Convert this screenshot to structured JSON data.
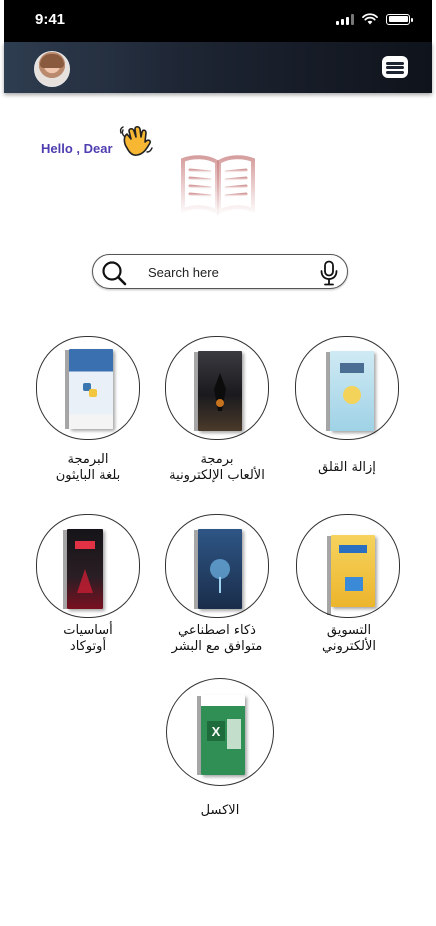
{
  "status_bar": {
    "time": "9:41"
  },
  "header": {
    "avatar": "user-avatar",
    "menu_icon": "menu-list-icon"
  },
  "greeting": {
    "text": "Hello , Dear",
    "icon": "waving-hand-icon"
  },
  "logo": {
    "icon": "open-book-icon"
  },
  "search": {
    "placeholder": "Search here",
    "value": "",
    "search_icon": "search-icon",
    "mic_icon": "microphone-icon"
  },
  "categories": [
    {
      "line1": "البرمجة",
      "line2": "بلغة البايثون",
      "cover_color": "#8fb3d9"
    },
    {
      "line1": "برمجة",
      "line2": "الألعاب الإلكترونية",
      "cover_color": "#2a2b30"
    },
    {
      "line1": "إزالة القلق",
      "line2": "",
      "cover_color": "#bfe1ef"
    },
    {
      "line1": "أساسيات",
      "line2": "أوتوكاد",
      "cover_color": "#1c1b1f"
    },
    {
      "line1": "ذكاء اصطناعي",
      "line2": "متوافق مع البشر",
      "cover_color": "#2c4f7c"
    },
    {
      "line1": "التسويق",
      "line2": "الألكتروني",
      "cover_color": "#f3c64a"
    },
    {
      "line1": "الاكسل",
      "line2": "",
      "cover_color": "#2f8f55"
    }
  ],
  "colors": {
    "greeting": "#4e3fb0",
    "app_bar_start": "#2e3d50",
    "app_bar_end": "#0f131b"
  }
}
